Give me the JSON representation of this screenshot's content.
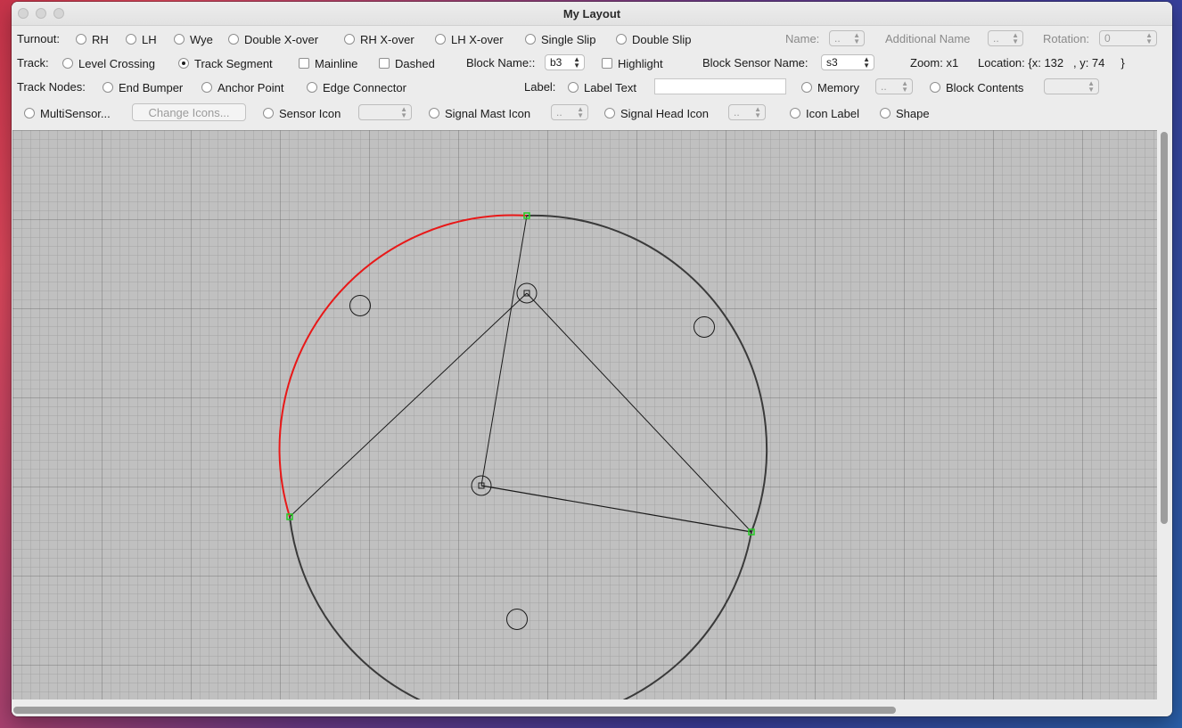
{
  "window": {
    "title": "My Layout"
  },
  "turnout": {
    "label": "Turnout:",
    "options": [
      "RH",
      "LH",
      "Wye",
      "Double X-over",
      "RH X-over",
      "LH X-over",
      "Single Slip",
      "Double Slip"
    ],
    "name_label": "Name:",
    "name_value": "..",
    "additional_name_label": "Additional Name",
    "additional_name_value": "..",
    "rotation_label": "Rotation:",
    "rotation_value": "0"
  },
  "track": {
    "label": "Track:",
    "level_crossing": "Level Crossing",
    "track_segment": "Track Segment",
    "mainline": "Mainline",
    "dashed": "Dashed",
    "block_name_label": "Block Name::",
    "block_name_value": "b3",
    "highlight": "Highlight",
    "block_sensor_label": "Block Sensor Name:",
    "block_sensor_value": "s3",
    "zoom": "Zoom: x1",
    "location": "Location: {x: 132   , y: 74     }"
  },
  "track_nodes": {
    "label": "Track Nodes:",
    "end_bumper": "End Bumper",
    "anchor_point": "Anchor Point",
    "edge_connector": "Edge Connector",
    "label_label": "Label:",
    "label_text": "Label Text",
    "memory": "Memory",
    "memory_value": "..",
    "block_contents": "Block Contents",
    "block_contents_value": ""
  },
  "icons": {
    "multisensor": "MultiSensor...",
    "change_icons": "Change Icons...",
    "sensor_icon": "Sensor Icon",
    "sensor_icon_value": "",
    "signal_mast_icon": "Signal Mast Icon",
    "signal_mast_value": "..",
    "signal_head_icon": "Signal Head Icon",
    "signal_head_value": "..",
    "icon_label": "Icon Label",
    "shape": "Shape"
  },
  "colors": {
    "grid_fine": "#a3a3a3",
    "grid_major": "#777777",
    "canvas_bg": "#c0c0c0",
    "track_default": "#3a3a3a",
    "track_selected": "#e81818",
    "endpoint": "#22cc22"
  }
}
